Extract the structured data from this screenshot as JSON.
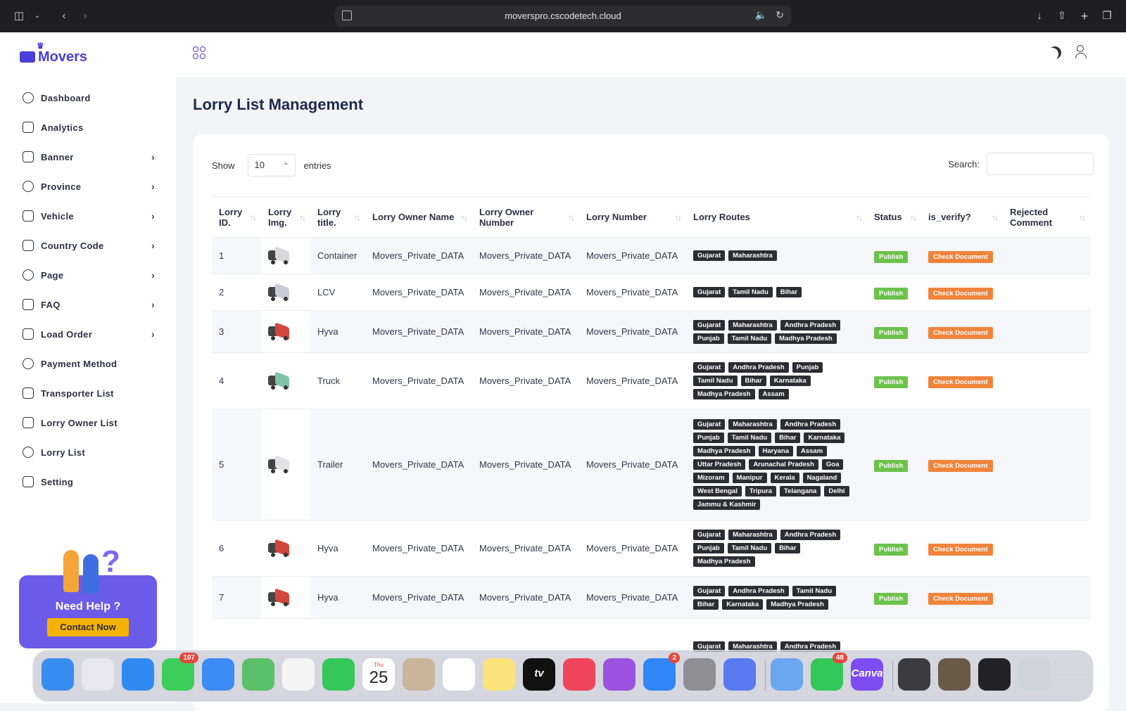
{
  "browser": {
    "url": "moverspro.cscodetech.cloud"
  },
  "brand": {
    "name": "Movers",
    "color": "#4a3fd8"
  },
  "sidebar": {
    "items": [
      {
        "label": "Dashboard",
        "icon": "home-icon",
        "has_submenu": false
      },
      {
        "label": "Analytics",
        "icon": "analytics-icon",
        "has_submenu": false
      },
      {
        "label": "Banner",
        "icon": "image-icon",
        "has_submenu": true
      },
      {
        "label": "Province",
        "icon": "location-pin-icon",
        "has_submenu": true
      },
      {
        "label": "Vehicle",
        "icon": "truck-icon",
        "has_submenu": true
      },
      {
        "label": "Country Code",
        "icon": "globe-icon",
        "has_submenu": true
      },
      {
        "label": "Page",
        "icon": "document-icon",
        "has_submenu": true
      },
      {
        "label": "FAQ",
        "icon": "chat-icon",
        "has_submenu": true
      },
      {
        "label": "Load Order",
        "icon": "box-icon",
        "has_submenu": true
      },
      {
        "label": "Payment Method",
        "icon": "wallet-icon",
        "has_submenu": false
      },
      {
        "label": "Transporter List",
        "icon": "user-icon",
        "has_submenu": false
      },
      {
        "label": "Lorry Owner List",
        "icon": "users-icon",
        "has_submenu": false
      },
      {
        "label": "Lorry List",
        "icon": "steering-icon",
        "has_submenu": false
      },
      {
        "label": "Setting",
        "icon": "sliders-icon",
        "has_submenu": false
      }
    ],
    "help": {
      "title": "Need Help ?",
      "button": "Contact Now"
    }
  },
  "page": {
    "title": "Lorry List Management",
    "show_label": "Show",
    "entries_value": "10",
    "entries_label": "entries",
    "search_label": "Search:"
  },
  "table": {
    "columns": [
      "Lorry ID.",
      "Lorry Img.",
      "Lorry title.",
      "Lorry Owner Name",
      "Lorry Owner Number",
      "Lorry Number",
      "Lorry Routes",
      "Status",
      "is_verify?",
      "Rejected Comment"
    ],
    "rows": [
      {
        "id": "1",
        "title": "Container",
        "owner_name": "Movers_Private_DATA",
        "owner_number": "Movers_Private_DATA",
        "lorry_number": "Movers_Private_DATA",
        "routes": [
          "Gujarat",
          "Maharashtra"
        ],
        "status": "Publish",
        "verify": "Check Document",
        "img_color": "#d8d8dc"
      },
      {
        "id": "2",
        "title": "LCV",
        "owner_name": "Movers_Private_DATA",
        "owner_number": "Movers_Private_DATA",
        "lorry_number": "Movers_Private_DATA",
        "routes": [
          "Gujarat",
          "Tamil Nadu",
          "Bihar"
        ],
        "status": "Publish",
        "verify": "Check Document",
        "img_color": "#c9ccd6"
      },
      {
        "id": "3",
        "title": "Hyva",
        "owner_name": "Movers_Private_DATA",
        "owner_number": "Movers_Private_DATA",
        "lorry_number": "Movers_Private_DATA",
        "routes": [
          "Gujarat",
          "Maharashtra",
          "Andhra Pradesh",
          "Punjab",
          "Tamil Nadu",
          "Madhya Pradesh"
        ],
        "status": "Publish",
        "verify": "Check Document",
        "img_color": "#d2473b"
      },
      {
        "id": "4",
        "title": "Truck",
        "owner_name": "Movers_Private_DATA",
        "owner_number": "Movers_Private_DATA",
        "lorry_number": "Movers_Private_DATA",
        "routes": [
          "Gujarat",
          "Andhra Pradesh",
          "Punjab",
          "Tamil Nadu",
          "Bihar",
          "Karnataka",
          "Madhya Pradesh",
          "Assam"
        ],
        "status": "Publish",
        "verify": "Check Document",
        "img_color": "#7fc2a8"
      },
      {
        "id": "5",
        "title": "Trailer",
        "owner_name": "Movers_Private_DATA",
        "owner_number": "Movers_Private_DATA",
        "lorry_number": "Movers_Private_DATA",
        "routes": [
          "Gujarat",
          "Maharashtra",
          "Andhra Pradesh",
          "Punjab",
          "Tamil Nadu",
          "Bihar",
          "Karnataka",
          "Madhya Pradesh",
          "Haryana",
          "Assam",
          "Uttar Pradesh",
          "Arunachal Pradesh",
          "Goa",
          "Mizoram",
          "Manipur",
          "Kerala",
          "Nagaland",
          "West Bengal",
          "Tripura",
          "Telangana",
          "Delhi",
          "Jammu & Kashmir"
        ],
        "status": "Publish",
        "verify": "Check Document",
        "img_color": "#e2e2e6"
      },
      {
        "id": "6",
        "title": "Hyva",
        "owner_name": "Movers_Private_DATA",
        "owner_number": "Movers_Private_DATA",
        "lorry_number": "Movers_Private_DATA",
        "routes": [
          "Gujarat",
          "Maharashtra",
          "Andhra Pradesh",
          "Punjab",
          "Tamil Nadu",
          "Bihar",
          "Madhya Pradesh"
        ],
        "status": "Publish",
        "verify": "Check Document",
        "img_color": "#d2473b"
      },
      {
        "id": "7",
        "title": "Hyva",
        "owner_name": "Movers_Private_DATA",
        "owner_number": "Movers_Private_DATA",
        "lorry_number": "Movers_Private_DATA",
        "routes": [
          "Gujarat",
          "Andhra Pradesh",
          "Tamil Nadu",
          "Bihar",
          "Karnataka",
          "Madhya Pradesh"
        ],
        "status": "Publish",
        "verify": "Check Document",
        "img_color": "#d2473b"
      },
      {
        "id": "",
        "title": "",
        "owner_name": "",
        "owner_number": "",
        "lorry_number": "",
        "routes": [
          "Gujarat",
          "Maharashtra",
          "Andhra Pradesh"
        ],
        "status": "",
        "verify": "",
        "img_color": ""
      }
    ]
  },
  "dock": {
    "apps": [
      {
        "name": "finder-icon",
        "color": "#3a8df0"
      },
      {
        "name": "launchpad-icon",
        "color": "#e8e8ee"
      },
      {
        "name": "safari-icon",
        "color": "#2f8bf2"
      },
      {
        "name": "messages-icon",
        "color": "#3ccd5a",
        "badge": "107"
      },
      {
        "name": "mail-icon",
        "color": "#3b8cf5"
      },
      {
        "name": "maps-icon",
        "color": "#5cc06a"
      },
      {
        "name": "photos-icon",
        "color": "#f4f4f4"
      },
      {
        "name": "facetime-icon",
        "color": "#35c759"
      },
      {
        "name": "calendar-icon",
        "color": "#ffffff",
        "day": "Thu",
        "date": "25"
      },
      {
        "name": "contacts-icon",
        "color": "#c9b59a"
      },
      {
        "name": "reminders-icon",
        "color": "#ffffff"
      },
      {
        "name": "notes-icon",
        "color": "#fbe27a"
      },
      {
        "name": "tv-icon",
        "color": "#111111",
        "label": "tv"
      },
      {
        "name": "music-icon",
        "color": "#f0445a"
      },
      {
        "name": "podcasts-icon",
        "color": "#9b52e0"
      },
      {
        "name": "appstore-icon",
        "color": "#2f86f6",
        "badge": "2"
      },
      {
        "name": "settings-icon",
        "color": "#8e8e93"
      },
      {
        "name": "simulator-icon",
        "color": "#5a7af0"
      },
      {
        "name": "remote-icon",
        "color": "#6aa7ef"
      },
      {
        "name": "whatsapp-icon",
        "color": "#34c759",
        "badge": "48"
      },
      {
        "name": "canva-icon",
        "color": "#7d4cf2",
        "label": "Canva"
      },
      {
        "name": "thumbnail-1-icon",
        "color": "#3b3b40"
      },
      {
        "name": "thumbnail-2-icon",
        "color": "#6a5a48"
      },
      {
        "name": "thumbnail-3-icon",
        "color": "#222226"
      },
      {
        "name": "trash-icon",
        "color": "#cfd4da"
      }
    ]
  }
}
